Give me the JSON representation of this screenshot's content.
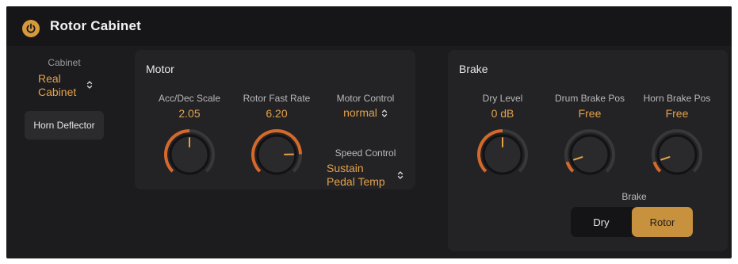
{
  "header": {
    "title": "Rotor Cabinet",
    "power_icon": "power-icon"
  },
  "cabinet": {
    "label": "Cabinet",
    "value_line1": "Real",
    "value_line2": "Cabinet"
  },
  "horn_deflector": {
    "label": "Horn Deflector"
  },
  "motor": {
    "title": "Motor",
    "acc_dec_scale": {
      "label": "Acc/Dec Scale",
      "value": "2.05",
      "level": 0.5
    },
    "rotor_fast_rate": {
      "label": "Rotor Fast Rate",
      "value": "6.20",
      "level": 0.83
    },
    "motor_control": {
      "label": "Motor Control",
      "value": "normal"
    },
    "speed_control": {
      "label": "Speed Control",
      "value_line1": "Sustain",
      "value_line2": "Pedal Temp"
    }
  },
  "brake": {
    "title": "Brake",
    "dry_level": {
      "label": "Dry Level",
      "value": "0 dB",
      "level": 0.5
    },
    "drum_brake_pos": {
      "label": "Drum Brake Pos",
      "value": "Free",
      "level": 0.1
    },
    "horn_brake_pos": {
      "label": "Horn Brake Pos",
      "value": "Free",
      "level": 0.1
    },
    "brake_switch": {
      "label": "Brake",
      "options": [
        "Dry",
        "Rotor"
      ],
      "selected": "Rotor"
    }
  },
  "colors": {
    "accent": "#e3a24a",
    "panel": "#232326",
    "background": "#1c1c1e",
    "selected_button": "#c7913e"
  }
}
